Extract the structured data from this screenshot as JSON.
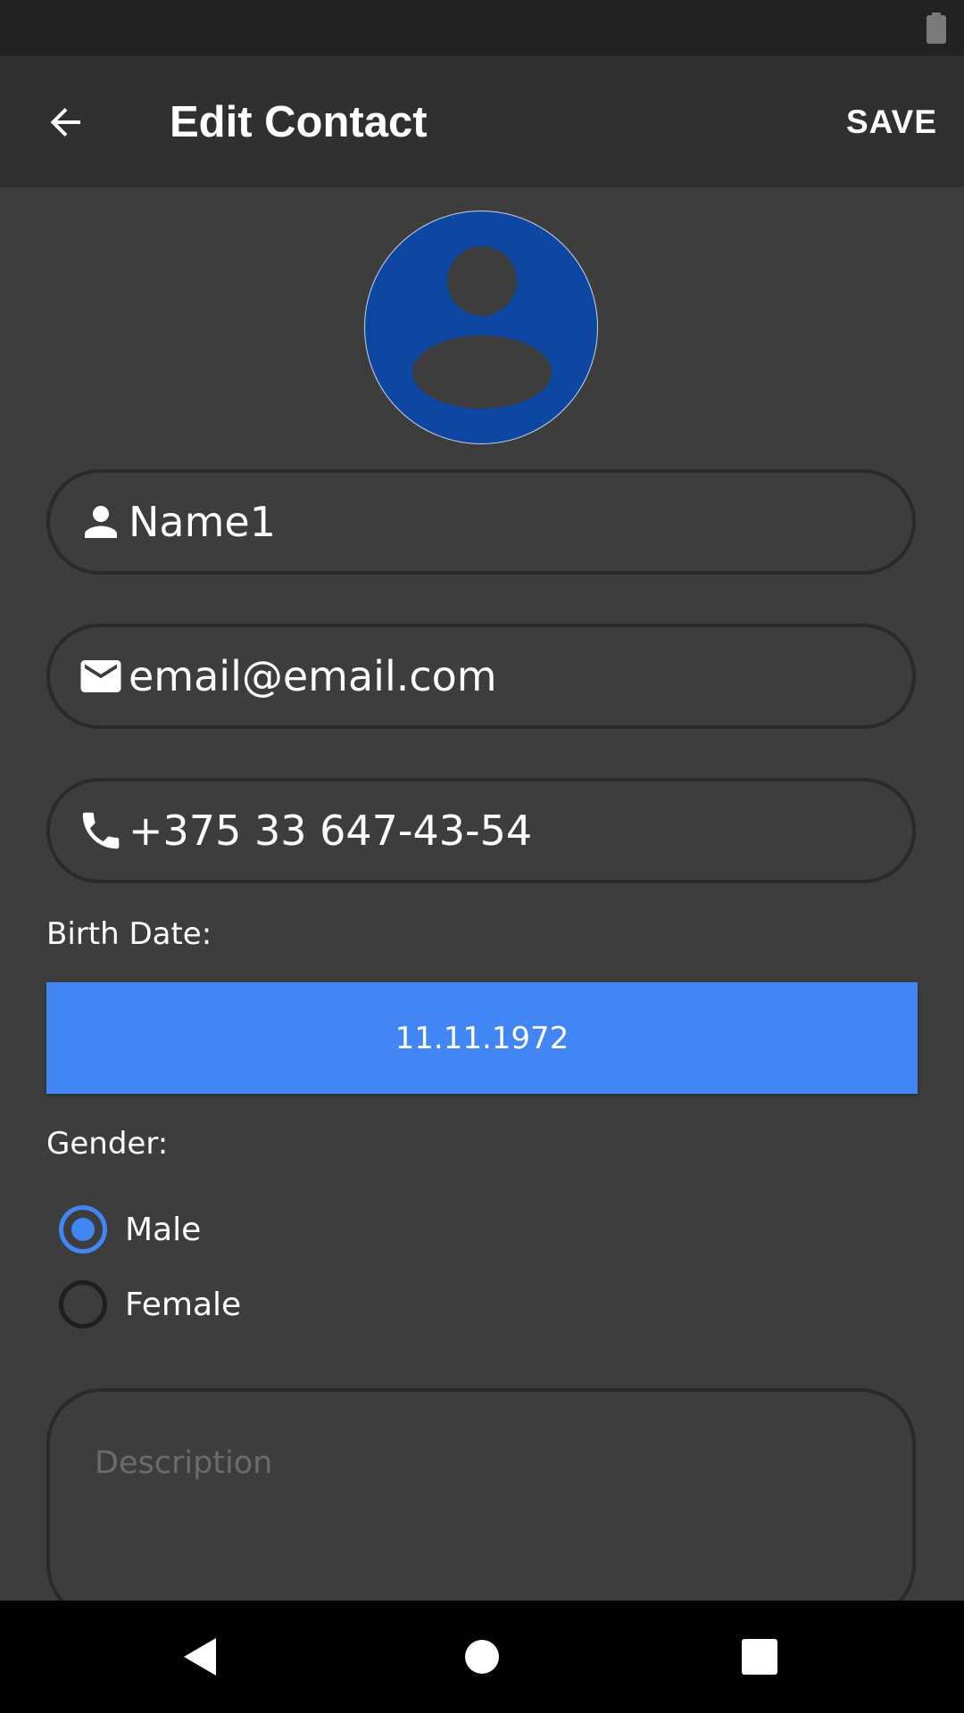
{
  "app_bar": {
    "title": "Edit Contact",
    "save_label": "SAVE"
  },
  "avatar": {
    "icon": "person-avatar-icon",
    "background_color": "#0d47a1"
  },
  "fields": {
    "name": {
      "icon": "person-icon",
      "value": "Name1"
    },
    "email": {
      "icon": "email-icon",
      "value": "email@email.com"
    },
    "phone": {
      "icon": "phone-icon",
      "value": "+375 33 647-43-54"
    }
  },
  "birth_date": {
    "label": "Birth Date:",
    "value": "11.11.1972",
    "button_color": "#4285f4"
  },
  "gender": {
    "label": "Gender:",
    "options": [
      {
        "label": "Male",
        "checked": true
      },
      {
        "label": "Female",
        "checked": false
      }
    ]
  },
  "description": {
    "placeholder": "Description",
    "value": ""
  },
  "nav": {
    "back": "nav-back-icon",
    "home": "nav-home-icon",
    "recents": "nav-recents-icon"
  }
}
